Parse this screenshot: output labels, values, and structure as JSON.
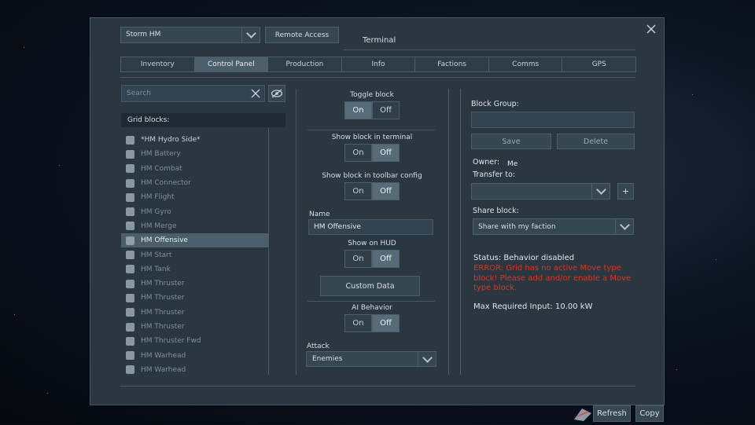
{
  "ship_selector": {
    "value": "Storm HM"
  },
  "remote_access_label": "Remote Access",
  "window_title": "Terminal",
  "tabs": [
    {
      "label": "Inventory"
    },
    {
      "label": "Control Panel"
    },
    {
      "label": "Production"
    },
    {
      "label": "Info"
    },
    {
      "label": "Factions"
    },
    {
      "label": "Comms"
    },
    {
      "label": "GPS"
    }
  ],
  "active_tab": "Control Panel",
  "search": {
    "placeholder": "Search"
  },
  "grid_blocks_header": "Grid blocks:",
  "blocks": [
    {
      "label": "*HM Hydro Side*"
    },
    {
      "label": "HM Battery"
    },
    {
      "label": "HM Combat"
    },
    {
      "label": "HM Connector"
    },
    {
      "label": "HM Flight"
    },
    {
      "label": "HM Gyro"
    },
    {
      "label": "HM Merge"
    },
    {
      "label": "HM Offensive"
    },
    {
      "label": "HM Start"
    },
    {
      "label": "HM Tank"
    },
    {
      "label": "HM Thruster"
    },
    {
      "label": "HM Thruster"
    },
    {
      "label": "HM Thruster"
    },
    {
      "label": "HM Thruster"
    },
    {
      "label": "HM Thruster Fwd"
    },
    {
      "label": "HM Warhead"
    },
    {
      "label": "HM Warhead"
    }
  ],
  "selected_block": "HM Offensive",
  "controls": {
    "toggle_block": {
      "label": "Toggle block",
      "on": "On",
      "off": "Off",
      "value": "On"
    },
    "show_in_terminal": {
      "label": "Show block in terminal",
      "on": "On",
      "off": "Off",
      "value": "Off"
    },
    "show_in_toolbar": {
      "label": "Show block in toolbar config",
      "on": "On",
      "off": "Off",
      "value": "Off"
    },
    "name_label": "Name",
    "name_value": "HM Offensive",
    "show_on_hud": {
      "label": "Show on HUD",
      "on": "On",
      "off": "Off",
      "value": "Off"
    },
    "custom_data_label": "Custom Data",
    "ai_behavior": {
      "label": "AI Behavior",
      "on": "On",
      "off": "Off",
      "value": "Off"
    },
    "attack_label": "Attack",
    "attack_value": "Enemies"
  },
  "right": {
    "block_group_label": "Block Group:",
    "save_label": "Save",
    "delete_label": "Delete",
    "owner_label": "Owner:",
    "owner_value": "Me",
    "transfer_label": "Transfer to:",
    "plus_label": "+",
    "share_label": "Share block:",
    "share_value": "Share with my faction",
    "status": "Status: Behavior disabled",
    "error": "ERROR: Grid has no active Move type block! Please add and/or enable a Move type block.",
    "max_input": "Max Required Input: 10.00 kW"
  },
  "bottom": {
    "refresh_label": "Refresh",
    "copy_label": "Copy"
  },
  "colors": {
    "error": "#e0301e",
    "panel": "#2a3740",
    "active_tab": "#4b5e6a"
  }
}
